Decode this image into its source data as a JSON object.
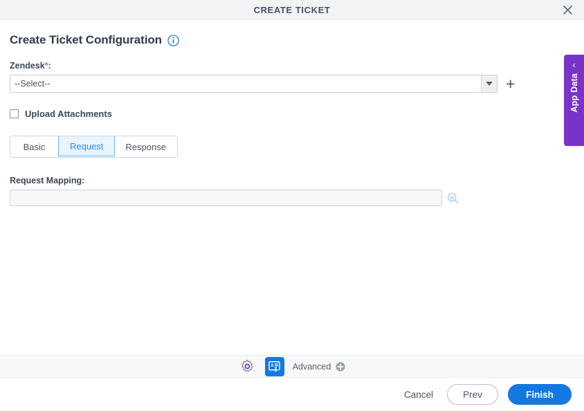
{
  "window": {
    "title": "CREATE TICKET",
    "close_icon": "close-icon"
  },
  "page": {
    "heading": "Create Ticket Configuration",
    "info_icon": "info-circle-icon"
  },
  "connection_field": {
    "label": "Zendesk",
    "required_marker": "*",
    "colon": ":",
    "selected_value": "--Select--",
    "dropdown_icon": "chevron-down-icon",
    "add_icon": "plus-icon"
  },
  "upload_attachments": {
    "label": "Upload Attachments",
    "checked": false
  },
  "tabs": [
    {
      "label": "Basic",
      "active": false
    },
    {
      "label": "Request",
      "active": true
    },
    {
      "label": "Response",
      "active": false
    }
  ],
  "request_mapping": {
    "label": "Request Mapping:",
    "value": "",
    "placeholder": "",
    "search_icon": "search-icon"
  },
  "app_data_panel": {
    "label": "App Data",
    "chevron": "‹",
    "color": "#7a33c9"
  },
  "advanced_toolbar": {
    "settings_icon": "gear-icon",
    "card_icon": "add-card-icon",
    "advanced_label": "Advanced",
    "advanced_add_icon": "plus-circle-icon"
  },
  "footer": {
    "cancel_label": "Cancel",
    "prev_label": "Prev",
    "finish_label": "Finish"
  },
  "colors": {
    "accent_blue": "#1478e0",
    "active_tab_blue": "#2b8cf0",
    "purple": "#7a33c9",
    "required_red": "#e05c4a",
    "title_text": "#44506b"
  }
}
